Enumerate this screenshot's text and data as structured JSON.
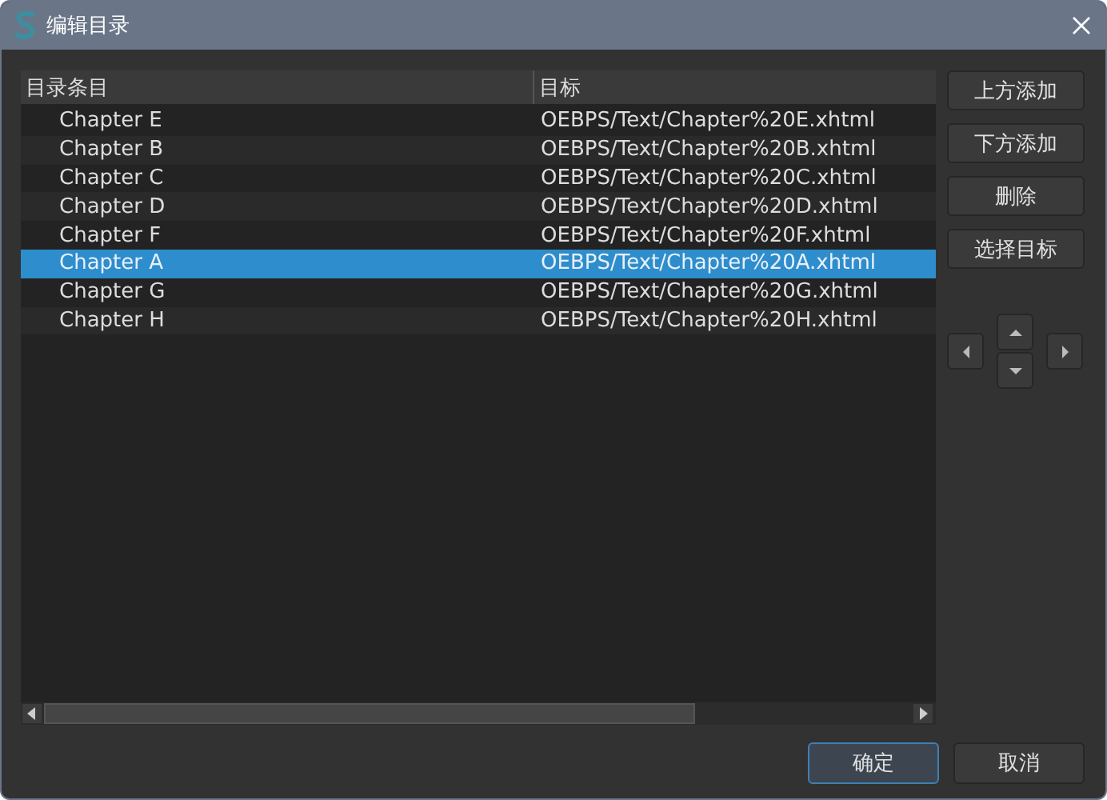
{
  "window": {
    "title": "编辑目录"
  },
  "table": {
    "columns": [
      "目录条目",
      "目标"
    ],
    "rows": [
      {
        "entry": "Chapter E",
        "target": "OEBPS/Text/Chapter%20E.xhtml",
        "selected": false
      },
      {
        "entry": "Chapter B",
        "target": "OEBPS/Text/Chapter%20B.xhtml",
        "selected": false
      },
      {
        "entry": "Chapter C",
        "target": "OEBPS/Text/Chapter%20C.xhtml",
        "selected": false
      },
      {
        "entry": "Chapter D",
        "target": "OEBPS/Text/Chapter%20D.xhtml",
        "selected": false
      },
      {
        "entry": "Chapter F",
        "target": "OEBPS/Text/Chapter%20F.xhtml",
        "selected": false
      },
      {
        "entry": "Chapter A",
        "target": "OEBPS/Text/Chapter%20A.xhtml",
        "selected": true
      },
      {
        "entry": "Chapter G",
        "target": "OEBPS/Text/Chapter%20G.xhtml",
        "selected": false
      },
      {
        "entry": "Chapter H",
        "target": "OEBPS/Text/Chapter%20H.xhtml",
        "selected": false
      }
    ]
  },
  "side_buttons": [
    "上方添加",
    "下方添加",
    "删除",
    "选择目标"
  ],
  "footer_buttons": [
    {
      "label": "确定",
      "kind": "default"
    },
    {
      "label": "取消",
      "kind": "normal"
    }
  ]
}
